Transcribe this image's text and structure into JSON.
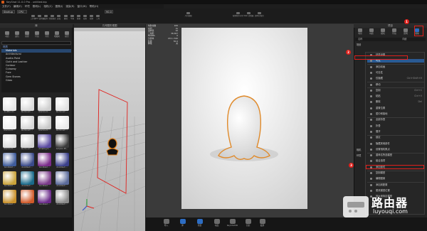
{
  "app": {
    "title": "KeyShot 11.0.0 Pro - untitled.bip"
  },
  "menubar": [
    "文件(F)",
    "编辑(E)",
    "环境",
    "照明(L)",
    "相机(C)",
    "图像(I)",
    "渲染(R)",
    "窗口(W)",
    "帮助(H)"
  ],
  "toolbar": {
    "workspace_dd": "Startup",
    "cpu_dd": "CPU",
    "cpu_value": "90.0",
    "buttons": [
      "工作区",
      "CPU 使用量",
      "暂停",
      "性能模式",
      "去噪",
      "翻转",
      "平移",
      "推移",
      "视角",
      "视野",
      "工具",
      "几何视图",
      "配置程序向导",
      "Web 查看器",
      "脚本控制台"
    ],
    "lighting_label": "暗调"
  },
  "library": {
    "title": "库",
    "tabs": [
      "材质",
      "颜色",
      "纹理",
      "环境",
      "背景",
      "收藏夹",
      "模型"
    ],
    "tree": [
      {
        "label": "材质",
        "root": true
      },
      {
        "label": "Materials",
        "sel": true
      },
      {
        "label": "Architectural"
      },
      {
        "label": "Axalta Paint"
      },
      {
        "label": "Cloth and Leather"
      },
      {
        "label": "Contour"
      },
      {
        "label": "Cutaway"
      },
      {
        "label": "Fuzz"
      },
      {
        "label": "Gem Stones"
      },
      {
        "label": "Glass"
      }
    ],
    "thumbs": [
      "A Little Lit...",
      "Aluminum ...",
      "Aluminum ...",
      "Aluminum ...",
      "Aluminum ...",
      "Aluminum ...",
      "Aluminum ...",
      "Aluminum ...",
      "Aluminum ...",
      "Aluminum ...",
      "Amazing S...",
      "Ampere Mi...",
      "Anodized ...",
      "Anodized ...",
      "Anodized ...",
      "Anodized ...",
      "Anodized ...",
      "Anodized ...",
      "Anodized ...",
      "Anodized ...",
      "Anodized ...",
      "Anodized ...",
      "Anodized ...",
      "Anodized ..."
    ],
    "thumb_colors": [
      "#e6e6e6",
      "#d9d9d9",
      "#cfcfcf",
      "#e2e2e2",
      "#f0f0f0",
      "#d6d6d6",
      "#c8c8c8",
      "#eaeaea",
      "#dcdcdc",
      "#d2d2d2",
      "#5a4aa0",
      "#3a3a3a",
      "#3e5b9a",
      "#3a4a8a",
      "#7a2b8a",
      "#3a3f8a",
      "#c9a23a",
      "#1a6a8a",
      "#7a3a8a",
      "#5a6a9a",
      "#c8902a",
      "#d05a2a",
      "#6a2a8a",
      "#8a8a8a"
    ]
  },
  "geometry_view": {
    "title": "几何图形视图"
  },
  "hud": {
    "labels": [
      "每秒帧数",
      "时间",
      "采样值",
      "三角形",
      "NURBS",
      "分辨率",
      "焦距",
      "降噪"
    ],
    "values": [
      "166",
      "2s",
      "16",
      "36,367",
      "0",
      "474 x 340",
      "50.0",
      "关"
    ]
  },
  "project": {
    "title": "项目",
    "tabs": [
      "场景",
      "材质",
      "相机",
      "环境",
      "照明",
      "图像"
    ],
    "list_header_left": "名称",
    "list_header_right": "详细",
    "root_items": [
      "场景",
      "相机",
      "环境"
    ]
  },
  "context_menu": {
    "items": [
      {
        "label": "材质设置",
        "sc": ""
      },
      {
        "label": "可见",
        "sc": "",
        "hl": true
      },
      {
        "label": "添加动画",
        "sc": ""
      },
      {
        "label": "可见性",
        "sc": ""
      },
      {
        "label": "仅隐藏",
        "sc": "Ctrl+Shift+H"
      },
      {
        "label": "移动",
        "sc": ""
      },
      {
        "label": "复制",
        "sc": "Ctrl+C"
      },
      {
        "label": "粘贴",
        "sc": "Ctrl+V"
      },
      {
        "label": "删除",
        "sc": "Del"
      },
      {
        "label": "重置位置",
        "sc": ""
      },
      {
        "label": "居中和接地",
        "sc": ""
      },
      {
        "label": "全部折叠",
        "sc": ""
      },
      {
        "label": "折叠",
        "sc": ""
      },
      {
        "label": "展开",
        "sc": ""
      },
      {
        "label": "锁定",
        "sc": ""
      },
      {
        "label": "隐藏其他部件",
        "sc": ""
      },
      {
        "label": "设置相机焦点",
        "sc": ""
      },
      {
        "label": "重命名所选模型",
        "sc": ""
      },
      {
        "label": "组合选项",
        "sc": ""
      },
      {
        "label": "添加剖切",
        "sc": ""
      },
      {
        "label": "复制模型",
        "sc": ""
      },
      {
        "label": "编辑图案",
        "sc": ""
      },
      {
        "label": "添加到配置",
        "sc": ""
      },
      {
        "label": "更改模型位置",
        "sc": ""
      },
      {
        "label": "放大到特定模型",
        "sc": ""
      }
    ]
  },
  "bottombar": [
    "导入",
    "库",
    "项目",
    "动画",
    "KeyShotXR",
    "渲染",
    "截屏"
  ],
  "annotations": [
    "1",
    "2",
    "3"
  ],
  "watermark": {
    "cn": "路由器",
    "en": "luyouqi.com"
  }
}
